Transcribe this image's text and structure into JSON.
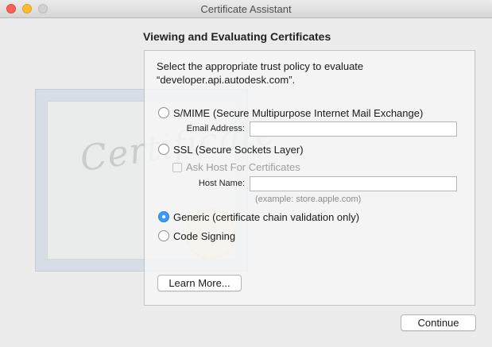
{
  "window": {
    "title": "Certificate Assistant"
  },
  "background_graphic": {
    "name": "certificate-icon",
    "script_text": "Certificate"
  },
  "heading": "Viewing and Evaluating Certificates",
  "instruction": "Select the appropriate trust policy to evaluate “developer.api.autodesk.com”.",
  "policies": {
    "smime": {
      "label": "S/MIME (Secure Multipurpose Internet Mail Exchange)",
      "selected": false
    },
    "ssl": {
      "label": "SSL (Secure Sockets Layer)",
      "selected": false
    },
    "generic": {
      "label": "Generic (certificate chain validation only)",
      "selected": true
    },
    "code_signing": {
      "label": "Code Signing",
      "selected": false
    }
  },
  "fields": {
    "email_label": "Email Address:",
    "email_value": "",
    "ask_host_label": "Ask Host For Certificates",
    "ask_host_checked": false,
    "host_label": "Host Name:",
    "host_value": "",
    "host_example": "(example: store.apple.com)"
  },
  "buttons": {
    "learn_more": "Learn More...",
    "continue": "Continue"
  },
  "colors": {
    "accent": "#3b99fc",
    "close": "#fc5f57",
    "minimize": "#fdbc2e"
  }
}
